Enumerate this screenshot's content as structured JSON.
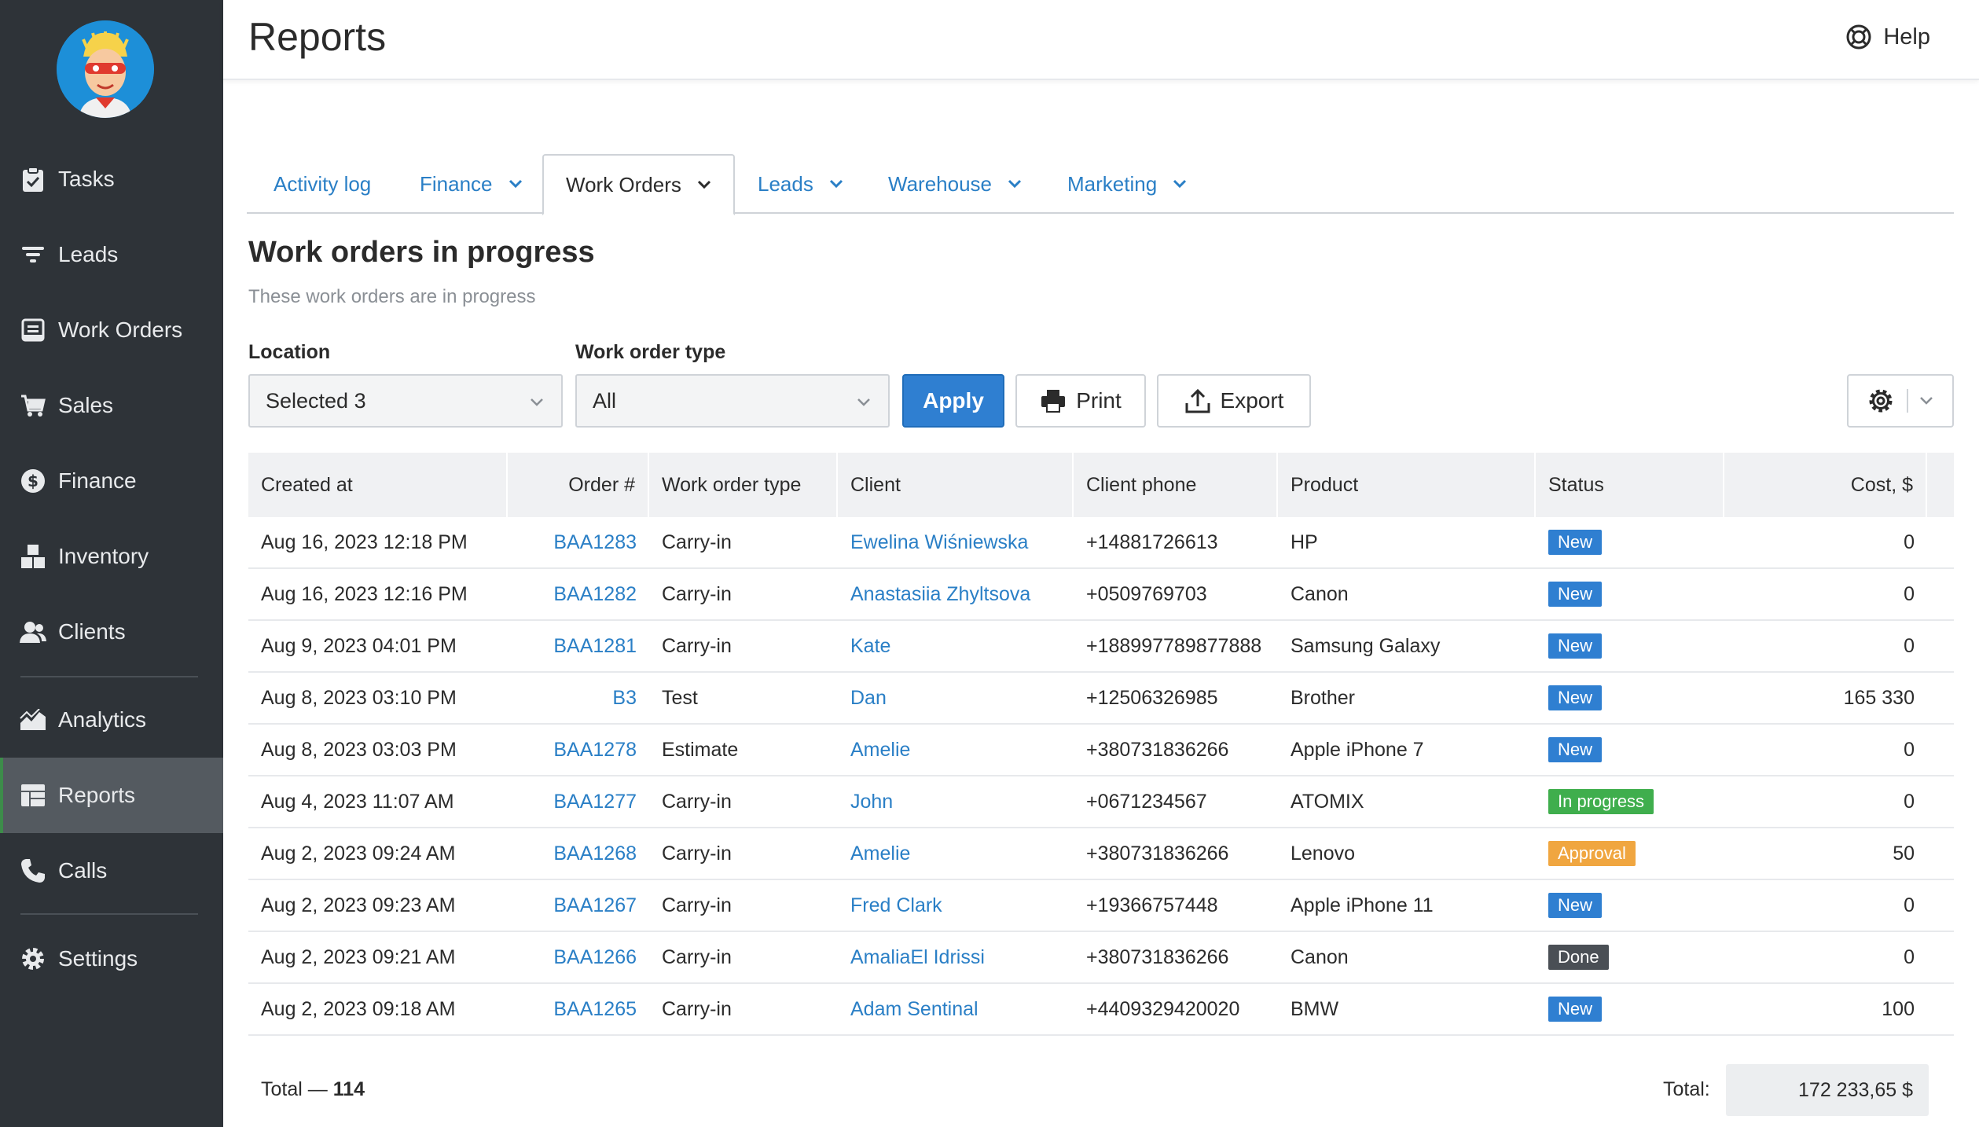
{
  "app": {
    "title": "Reports",
    "help_label": "Help"
  },
  "sidebar": {
    "items": [
      {
        "label": "Tasks",
        "icon": "clipboard-icon"
      },
      {
        "label": "Leads",
        "icon": "filter-icon"
      },
      {
        "label": "Work Orders",
        "icon": "work-order-icon"
      },
      {
        "label": "Sales",
        "icon": "cart-icon"
      },
      {
        "label": "Finance",
        "icon": "dollar-icon"
      },
      {
        "label": "Inventory",
        "icon": "boxes-icon"
      },
      {
        "label": "Clients",
        "icon": "users-icon"
      },
      {
        "label": "Analytics",
        "icon": "chart-icon"
      },
      {
        "label": "Reports",
        "icon": "table-icon",
        "active": true
      },
      {
        "label": "Calls",
        "icon": "phone-icon"
      },
      {
        "label": "Settings",
        "icon": "gear-icon"
      }
    ]
  },
  "tabs": [
    {
      "label": "Activity log",
      "dropdown": false
    },
    {
      "label": "Finance",
      "dropdown": true
    },
    {
      "label": "Work Orders",
      "dropdown": true,
      "active": true
    },
    {
      "label": "Leads",
      "dropdown": true
    },
    {
      "label": "Warehouse",
      "dropdown": true
    },
    {
      "label": "Marketing",
      "dropdown": true
    }
  ],
  "report": {
    "title": "Work orders in progress",
    "subtitle": "These work orders are in progress"
  },
  "filters": {
    "location_label": "Location",
    "location_value": "Selected 3",
    "type_label": "Work order type",
    "type_value": "All"
  },
  "toolbar": {
    "apply_label": "Apply",
    "print_label": "Print",
    "export_label": "Export"
  },
  "table": {
    "columns": [
      "Created at",
      "Order #",
      "Work order type",
      "Client",
      "Client phone",
      "Product",
      "Status",
      "Cost, $"
    ],
    "rows": [
      {
        "created": "Aug 16, 2023 12:18 PM",
        "order": "BAA1283",
        "type": "Carry-in",
        "client": "Ewelina Wiśniewska",
        "phone": "+14881726613",
        "product": "HP",
        "status": "New",
        "cost": "0"
      },
      {
        "created": "Aug 16, 2023 12:16 PM",
        "order": "BAA1282",
        "type": "Carry-in",
        "client": "Anastasiia Zhyltsova",
        "phone": "+0509769703",
        "product": "Canon",
        "status": "New",
        "cost": "0"
      },
      {
        "created": "Aug 9, 2023 04:01 PM",
        "order": "BAA1281",
        "type": "Carry-in",
        "client": "Kate",
        "phone": "+188997789877888",
        "product": "Samsung Galaxy",
        "status": "New",
        "cost": "0"
      },
      {
        "created": "Aug 8, 2023 03:10 PM",
        "order": "B3",
        "type": "Test",
        "client": "Dan",
        "phone": "+12506326985",
        "product": "Brother",
        "status": "New",
        "cost": "165 330"
      },
      {
        "created": "Aug 8, 2023 03:03 PM",
        "order": "BAA1278",
        "type": "Estimate",
        "client": "Amelie",
        "phone": "+380731836266",
        "product": "Apple iPhone 7",
        "status": "New",
        "cost": "0"
      },
      {
        "created": "Aug 4, 2023 11:07 AM",
        "order": "BAA1277",
        "type": "Carry-in",
        "client": "John",
        "phone": "+0671234567",
        "product": "ATOMIX",
        "status": "In progress",
        "cost": "0"
      },
      {
        "created": "Aug 2, 2023 09:24 AM",
        "order": "BAA1268",
        "type": "Carry-in",
        "client": "Amelie",
        "phone": "+380731836266",
        "product": "Lenovo",
        "status": "Approval",
        "cost": "50"
      },
      {
        "created": "Aug 2, 2023 09:23 AM",
        "order": "BAA1267",
        "type": "Carry-in",
        "client": "Fred Clark",
        "phone": "+19366757448",
        "product": "Apple iPhone 11",
        "status": "New",
        "cost": "0"
      },
      {
        "created": "Aug 2, 2023 09:21 AM",
        "order": "BAA1266",
        "type": "Carry-in",
        "client": "AmaliaEl Idrissi",
        "phone": "+380731836266",
        "product": "Canon",
        "status": "Done",
        "cost": "0"
      },
      {
        "created": "Aug 2, 2023 09:18 AM",
        "order": "BAA1265",
        "type": "Carry-in",
        "client": "Adam Sentinal",
        "phone": "+4409329420020",
        "product": "BMW",
        "status": "New",
        "cost": "100"
      }
    ]
  },
  "status_colors": {
    "New": "#2f7fd1",
    "In progress": "#3fae4d",
    "Approval": "#f0a640",
    "Done": "#4a4f55"
  },
  "footer": {
    "total_count_label": "Total —",
    "total_count": "114",
    "total_label": "Total:",
    "total_value": "172 233,65 $"
  }
}
